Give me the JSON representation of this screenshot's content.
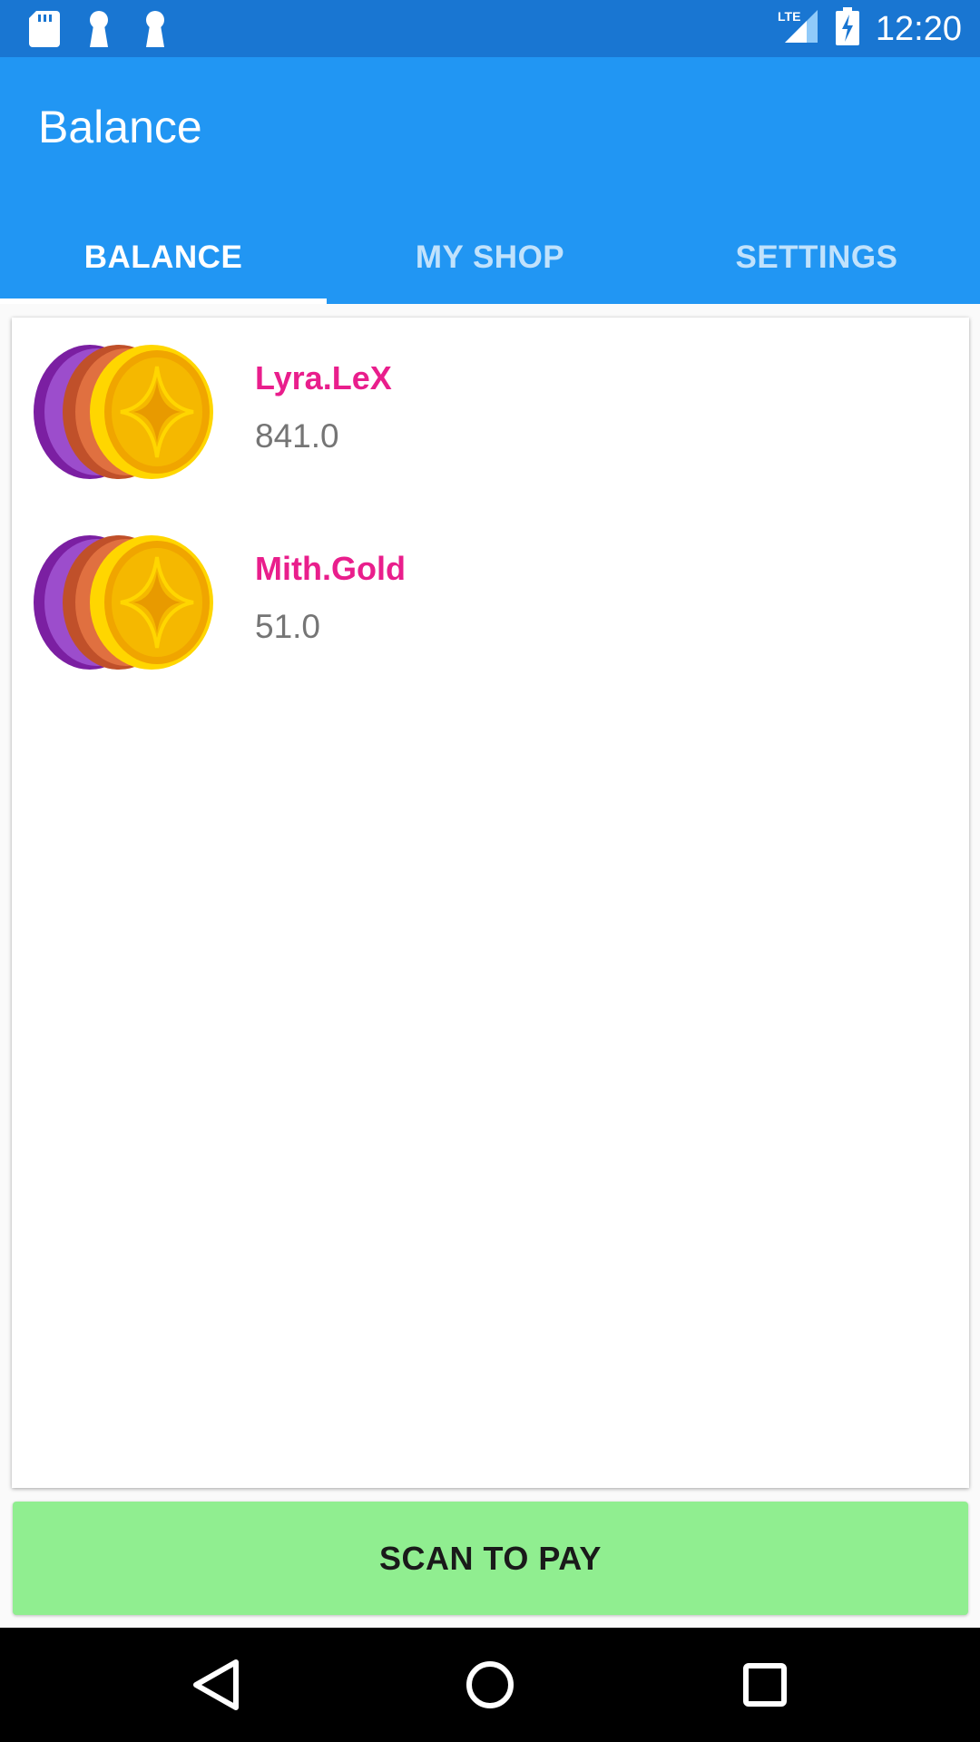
{
  "status_bar": {
    "time": "12:20",
    "network": "LTE",
    "icons": [
      "sd-card-icon",
      "keyhole-icon",
      "keyhole-icon",
      "lte-signal-icon",
      "battery-charging-icon"
    ]
  },
  "app_bar": {
    "title": "Balance",
    "color": "#2196f3"
  },
  "tabs": [
    {
      "label": "BALANCE",
      "active": true
    },
    {
      "label": "MY SHOP",
      "active": false
    },
    {
      "label": "SETTINGS",
      "active": false
    }
  ],
  "balances": [
    {
      "name": "Lyra.LeX",
      "amount": "841.0",
      "icon": "coins-icon"
    },
    {
      "name": "Mith.Gold",
      "amount": "51.0",
      "icon": "coins-icon"
    }
  ],
  "actions": {
    "scan_label": "SCAN TO PAY",
    "scan_color": "#90ee90"
  },
  "nav_bar": {
    "buttons": [
      "back-icon",
      "home-icon",
      "recents-icon"
    ]
  },
  "colors": {
    "status_bar": "#1976d2",
    "accent_name": "#e91e8c",
    "amount_text": "#757575"
  }
}
